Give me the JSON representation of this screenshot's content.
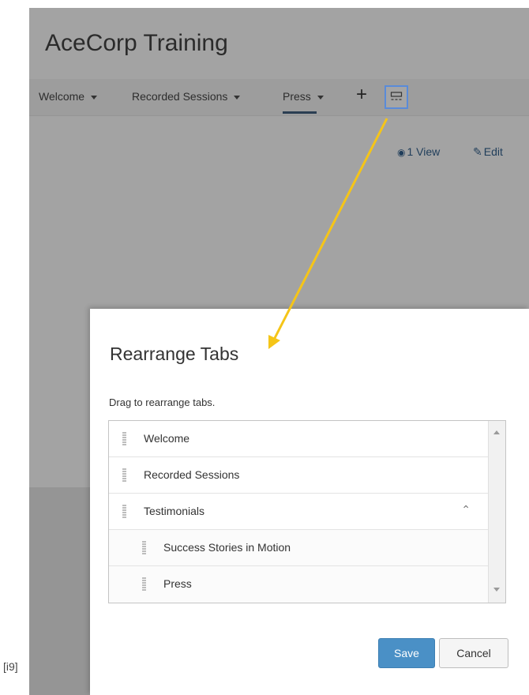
{
  "caption": "[i9]",
  "app": {
    "title": "AceCorp Training"
  },
  "tabs": {
    "items": [
      {
        "label": "Welcome",
        "dropdown": true
      },
      {
        "label": "Recorded Sessions",
        "dropdown": true
      },
      {
        "label": "Press",
        "dropdown": true,
        "active": true
      }
    ],
    "add_label": "+",
    "rearrange_icon": "rearrange-tabs-icon"
  },
  "page_actions": {
    "view_label": "1 View",
    "view_icon": "eye-icon",
    "edit_label": "Edit",
    "edit_icon": "pencil-icon"
  },
  "dialog": {
    "title": "Rearrange Tabs",
    "hint": "Drag to rearrange tabs.",
    "rows": [
      {
        "label": "Welcome",
        "level": 0
      },
      {
        "label": "Recorded Sessions",
        "level": 0
      },
      {
        "label": "Testimonials",
        "level": 0,
        "expanded": true
      },
      {
        "label": "Success Stories in Motion",
        "level": 1
      },
      {
        "label": "Press",
        "level": 1
      }
    ],
    "save_label": "Save",
    "cancel_label": "Cancel"
  },
  "colors": {
    "accent": "#4a90c6",
    "highlight_border": "#5a8bd9",
    "annotation_arrow": "#f5c518"
  }
}
